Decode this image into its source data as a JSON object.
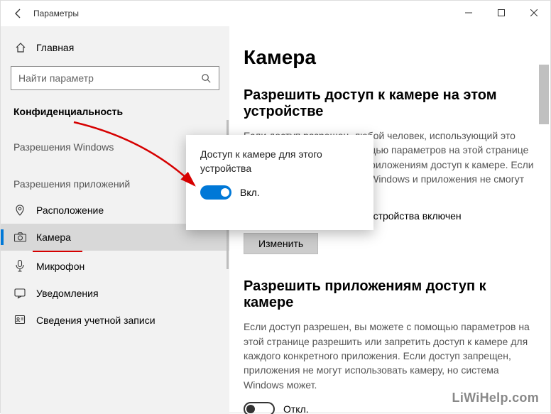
{
  "titlebar": {
    "title": "Параметры"
  },
  "sidebar": {
    "home": "Главная",
    "search_placeholder": "Найти параметр",
    "category": "Конфиденциальность",
    "group_windows": "Разрешения Windows",
    "group_apps": "Разрешения приложений",
    "items": {
      "location": "Расположение",
      "camera": "Камера",
      "microphone": "Микрофон",
      "notifications": "Уведомления",
      "account": "Сведения учетной записи"
    }
  },
  "content": {
    "h1": "Камера",
    "section1_title": "Разрешить доступ к камере на этом устройстве",
    "section1_desc": "Если доступ разрешен, любой человек, использующий это устройство, сможет с помощью параметров на этой странице разрешить или запретить приложениям доступ к камере. Если доступ запрещен, система Windows и приложения не смогут использовать камеру.",
    "status_line": "Доступ к камере для этого устройства включен",
    "change_btn": "Изменить",
    "section2_title": "Разрешить приложениям доступ к камере",
    "section2_desc": "Если доступ разрешен, вы можете с помощью параметров на этой странице разрешить или запретить доступ к камере для каждого конкретного приложения. Если доступ запрещен, приложения не могут использовать камеру, но система Windows может.",
    "toggle_off_label": "Откл."
  },
  "popup": {
    "title": "Доступ к камере для этого устройства",
    "toggle_on_label": "Вкл."
  },
  "watermark": "LiWiHelp.com"
}
